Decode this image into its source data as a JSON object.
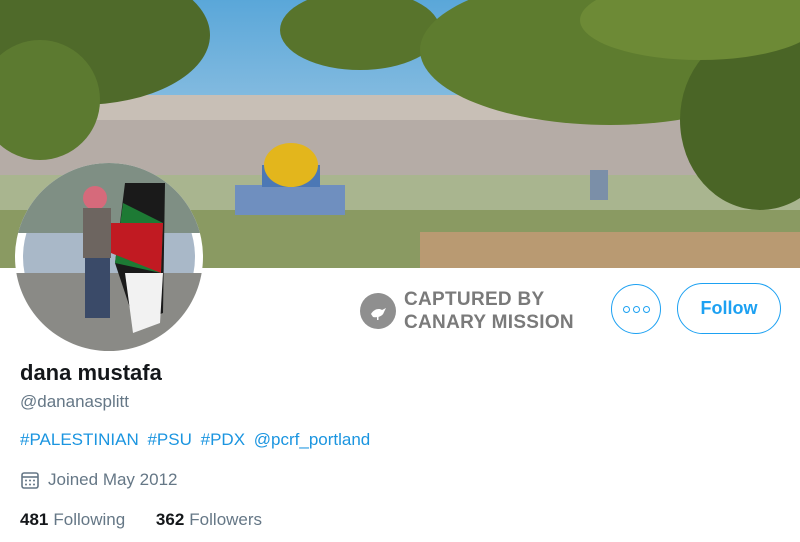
{
  "banner": {
    "description_icon": "city-skyline-banner"
  },
  "avatar": {
    "icon": "profile-photo"
  },
  "watermark": {
    "line1": "CAPTURED BY",
    "line2": "CANARY MISSION",
    "icon": "canary-bird-icon"
  },
  "actions": {
    "follow_label": "Follow",
    "more_icon": "more-options-icon"
  },
  "profile": {
    "name": "dana mustafa",
    "handle": "@dananasplitt",
    "bio": [
      "#PALESTINIAN",
      "#PSU",
      "#PDX",
      "@pcrf_portland"
    ],
    "joined": "Joined May 2012"
  },
  "stats": {
    "following_count": "481",
    "following_label": "Following",
    "followers_count": "362",
    "followers_label": "Followers"
  },
  "colors": {
    "accent": "#1da1f2",
    "link": "#1b95e0",
    "muted": "#657786"
  }
}
